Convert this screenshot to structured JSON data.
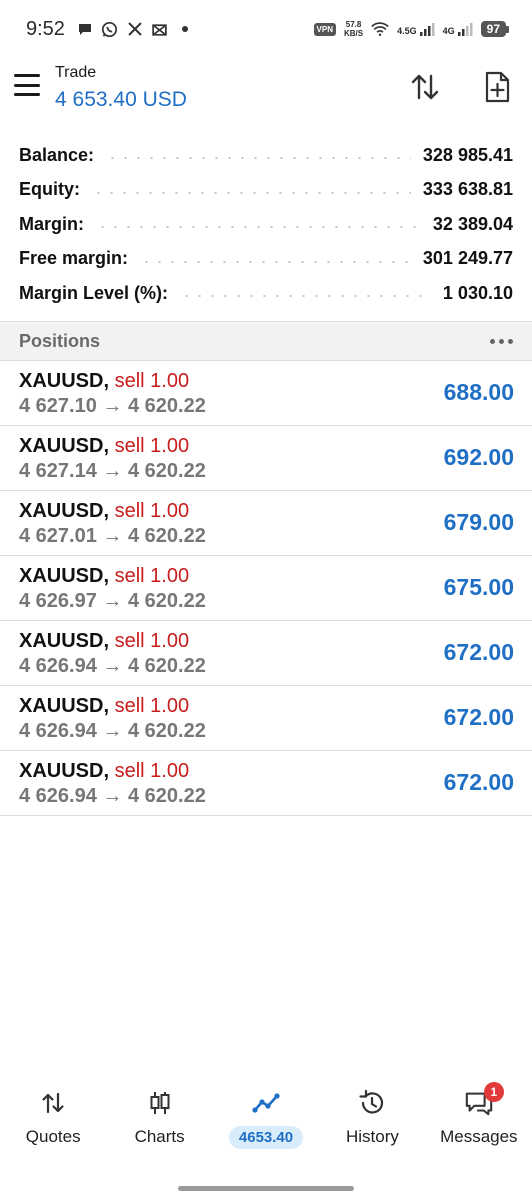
{
  "status_bar": {
    "time": "9:52",
    "vpn": "VPN",
    "speed_value": "57.8",
    "speed_unit": "KB/S",
    "net1": "4.5G",
    "net2": "4G",
    "battery": "97"
  },
  "header": {
    "title": "Trade",
    "balance": "4 653.40 USD"
  },
  "summary": [
    {
      "label": "Balance:",
      "value": "328 985.41"
    },
    {
      "label": "Equity:",
      "value": "333 638.81"
    },
    {
      "label": "Margin:",
      "value": "32 389.04"
    },
    {
      "label": "Free margin:",
      "value": "301 249.77"
    },
    {
      "label": "Margin Level (%):",
      "value": "1 030.10"
    }
  ],
  "positions": {
    "title": "Positions",
    "items": [
      {
        "symbol": "XAUUSD,",
        "side": "sell 1.00",
        "prices": "4 627.10 → 4 620.22",
        "profit": "688.00"
      },
      {
        "symbol": "XAUUSD,",
        "side": "sell 1.00",
        "prices": "4 627.14 → 4 620.22",
        "profit": "692.00"
      },
      {
        "symbol": "XAUUSD,",
        "side": "sell 1.00",
        "prices": "4 627.01 → 4 620.22",
        "profit": "679.00"
      },
      {
        "symbol": "XAUUSD,",
        "side": "sell 1.00",
        "prices": "4 626.97 → 4 620.22",
        "profit": "675.00"
      },
      {
        "symbol": "XAUUSD,",
        "side": "sell 1.00",
        "prices": "4 626.94 → 4 620.22",
        "profit": "672.00"
      },
      {
        "symbol": "XAUUSD,",
        "side": "sell 1.00",
        "prices": "4 626.94 → 4 620.22",
        "profit": "672.00"
      },
      {
        "symbol": "XAUUSD,",
        "side": "sell 1.00",
        "prices": "4 626.94 → 4 620.22",
        "profit": "672.00"
      }
    ]
  },
  "nav": {
    "items": [
      {
        "label": "Quotes",
        "icon": "quotes-arrows-icon"
      },
      {
        "label": "Charts",
        "icon": "candlestick-icon"
      },
      {
        "label": "4653.40",
        "icon": "trade-line-icon",
        "active": true
      },
      {
        "label": "History",
        "icon": "history-clock-icon"
      },
      {
        "label": "Messages",
        "icon": "messages-icon",
        "badge": "1"
      }
    ]
  },
  "colors": {
    "accent": "#1f6fc5",
    "sell": "#c81d1d",
    "badge": "#e23a3a"
  }
}
